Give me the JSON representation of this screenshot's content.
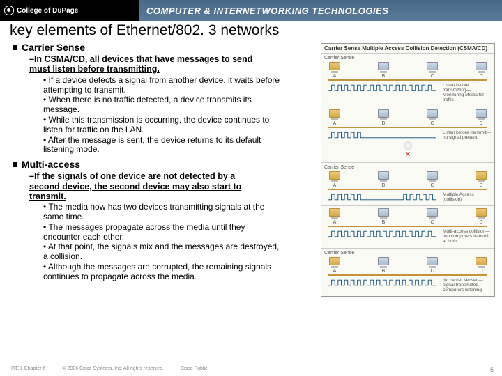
{
  "header": {
    "college": "College of DuPage",
    "course": "COMPUTER & INTERNETWORKING TECHNOLOGIES"
  },
  "title": "key elements of Ethernet/802. 3 networks",
  "s1": {
    "head": "Carrier Sense",
    "sub": "–In CSMA/CD, all devices that have messages to send must listen before transmitting.",
    "b1": "• If a device detects a signal from another device, it waits before attempting to transmit.",
    "b2": "• When there is no traffic detected, a device transmits its message.",
    "b3": "• While this transmission is occurring, the device continues to listen for traffic on the LAN.",
    "b4": "• After the message is sent, the device returns to its default listening mode."
  },
  "s2": {
    "head": "Multi-access",
    "sub": "–If the signals of one device are not detected by a second device, the second device may also start to transmit.",
    "b1": "• The media now has two devices transmitting signals at the same time.",
    "b2": "• The messages propagate across the media until they encounter each other.",
    "b3": "• At that point, the signals mix and the messages are destroyed, a collision.",
    "b4": "• Although the messages are corrupted, the remaining signals continues to propagate across the media."
  },
  "diag": {
    "title": "Carrier Sense Multiple Access Collision Detection (CSMA/CD)",
    "labels": {
      "a": "A",
      "b": "B",
      "c": "C",
      "d": "D"
    },
    "p1": {
      "tag": "Carrier Sense",
      "cap": "Listen before transmitting—Monitoring Media for traffic"
    },
    "p2": {
      "tag": "",
      "cap": "Listen before transmit—no signal present"
    },
    "p3": {
      "tag": "Carrier Sense",
      "cap": "Multiple Access (collision)"
    },
    "p4": {
      "tag": "",
      "cap": "Multi-access collision—two computers transmit at both"
    },
    "p5": {
      "tag": "Carrier Sense",
      "cap": "No carrier sensed—signal transmitted—computers listening"
    }
  },
  "footer": {
    "left": "ITE 1 Chapter 6",
    "mid": "© 2006 Cisco Systems, Inc. All rights reserved.",
    "right": "Cisco Public",
    "page": "5"
  }
}
